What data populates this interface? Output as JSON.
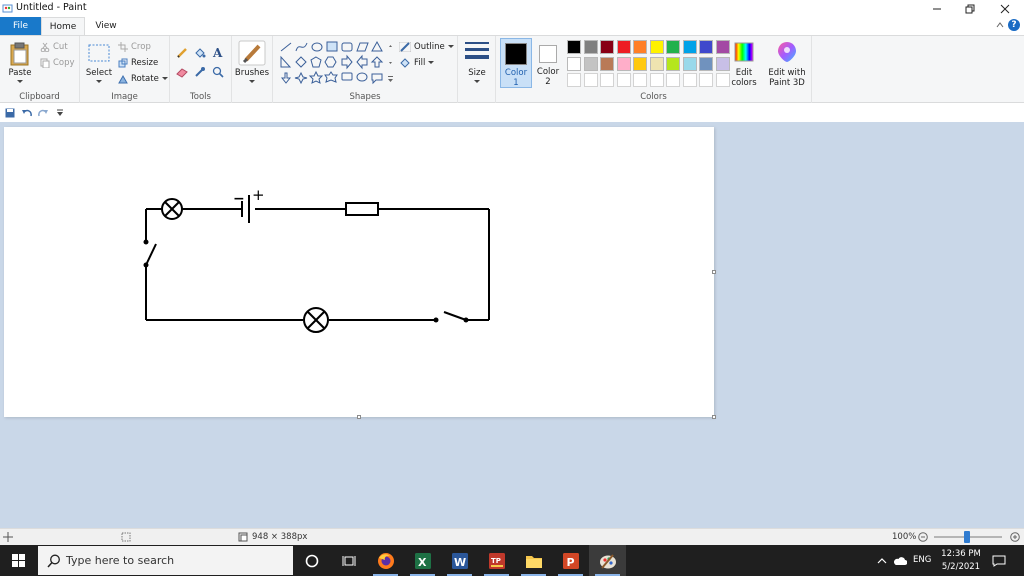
{
  "window": {
    "title": "Untitled - Paint"
  },
  "tabs": {
    "file": "File",
    "home": "Home",
    "view": "View"
  },
  "clipboard": {
    "paste": "Paste",
    "cut": "Cut",
    "copy": "Copy",
    "group": "Clipboard"
  },
  "image": {
    "select": "Select",
    "crop": "Crop",
    "resize": "Resize",
    "rotate": "Rotate",
    "group": "Image"
  },
  "tools": {
    "group": "Tools"
  },
  "brushes": {
    "label": "Brushes"
  },
  "shapes": {
    "outline": "Outline",
    "fill": "Fill",
    "group": "Shapes"
  },
  "size": {
    "label": "Size"
  },
  "colors": {
    "color1_label": "Color",
    "color1_num": "1",
    "color2_label": "Color",
    "color2_num": "2",
    "edit_colors_line1": "Edit",
    "edit_colors_line2": "colors",
    "group": "Colors",
    "color1_value": "#000000",
    "color2_value": "#ffffff",
    "palette": [
      "#000000",
      "#7f7f7f",
      "#880015",
      "#ed1c24",
      "#ff7f27",
      "#fff200",
      "#22b14c",
      "#00a2e8",
      "#3f48cc",
      "#a349a4",
      "#ffffff",
      "#c3c3c3",
      "#b97a57",
      "#ffaec9",
      "#ffc90e",
      "#efe4b0",
      "#b5e61d",
      "#99d9ea",
      "#7092be",
      "#c8bfe7"
    ]
  },
  "paint3d": {
    "line1": "Edit with",
    "line2": "Paint 3D"
  },
  "status": {
    "dimensions": "948 × 388px",
    "zoom": "100%"
  },
  "taskbar": {
    "search_placeholder": "Type here to search",
    "language": "ENG",
    "time": "12:36 PM",
    "date": "5/2/2021",
    "apps": [
      "cortana-icon",
      "task-view-icon",
      "firefox-icon",
      "excel-icon",
      "word-icon",
      "tp-app-icon",
      "file-explorer-icon",
      "powerpoint-icon",
      "paint-icon"
    ]
  },
  "drawing": {
    "description_components": [
      "lamp",
      "battery",
      "resistor",
      "switch",
      "lamp",
      "switch"
    ],
    "battery_minus": "−",
    "battery_plus": "+"
  }
}
